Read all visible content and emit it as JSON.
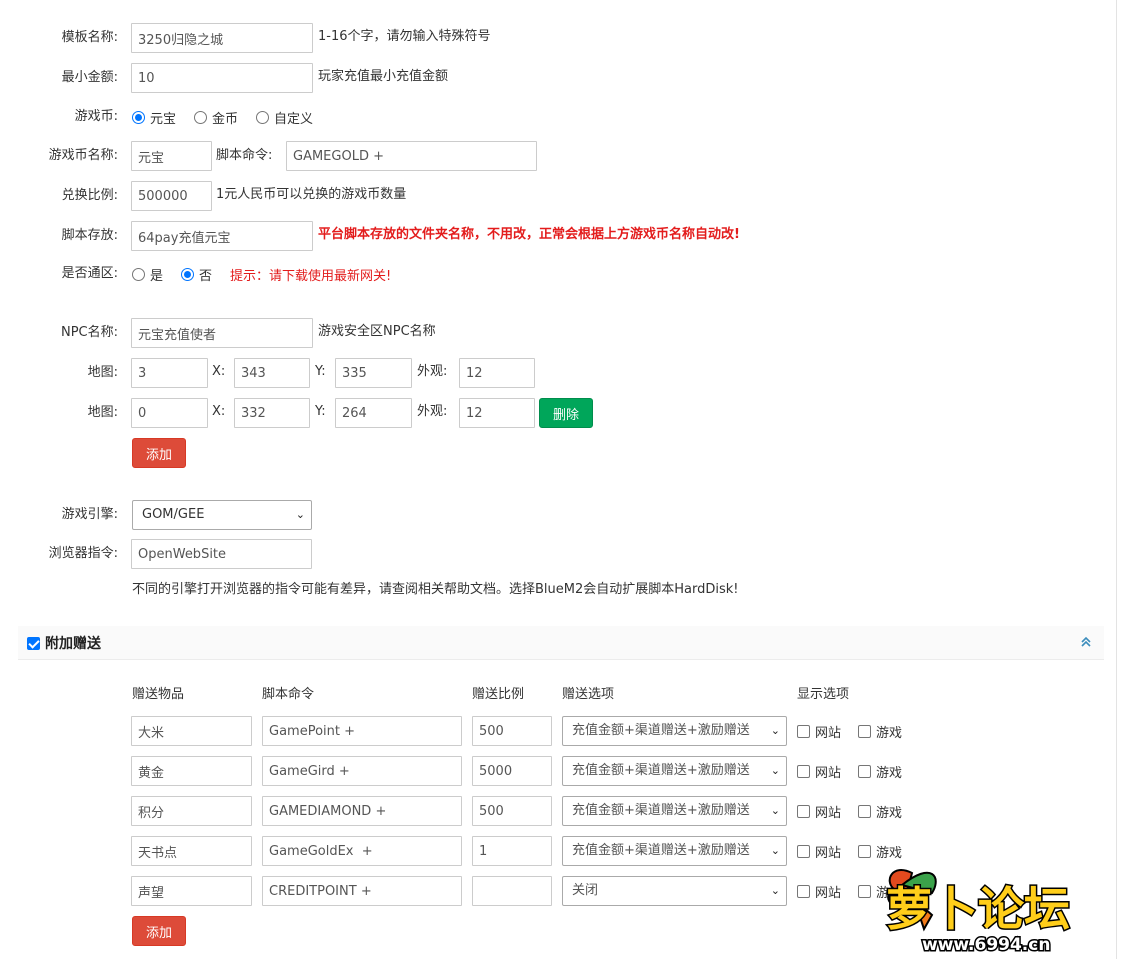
{
  "form": {
    "template_name": {
      "label": "模板名称:",
      "value": "3250归隐之城",
      "hint": "1-16个字，请勿输入特殊符号"
    },
    "min_amount": {
      "label": "最小金额:",
      "value": "10",
      "hint": "玩家充值最小充值金额"
    },
    "currency": {
      "label": "游戏币:",
      "options": [
        "元宝",
        "金币",
        "自定义"
      ],
      "selected": "元宝"
    },
    "currency_name": {
      "label": "游戏币名称:",
      "value": "元宝",
      "script_label": "脚本命令:",
      "script_value": "GAMEGOLD +"
    },
    "ratio": {
      "label": "兑换比例:",
      "value": "500000",
      "hint": "1元人民币可以兑换的游戏币数量"
    },
    "script_store": {
      "label": "脚本存放:",
      "value": "64pay充值元宝",
      "hint": "平台脚本存放的文件夹名称，不用改，正常会根据上方游戏币名称自动改!"
    },
    "all_zone": {
      "label": "是否通区:",
      "options": [
        "是",
        "否"
      ],
      "selected": "否",
      "hint": "提示：请下载使用最新网关!"
    },
    "npc_name": {
      "label": "NPC名称:",
      "value": "元宝充值使者",
      "hint": "游戏安全区NPC名称"
    },
    "maps": {
      "map_label": "地图:",
      "x_label": "X:",
      "y_label": "Y:",
      "look_label": "外观:",
      "rows": [
        {
          "map": "3",
          "x": "343",
          "y": "335",
          "look": "12"
        },
        {
          "map": "0",
          "x": "332",
          "y": "264",
          "look": "12",
          "delete_label": "删除"
        }
      ],
      "add_label": "添加"
    },
    "engine": {
      "label": "游戏引擎:",
      "value": "GOM/GEE"
    },
    "browser_cmd": {
      "label": "浏览器指令:",
      "value": "OpenWebSite",
      "note": "不同的引擎打开浏览器的指令可能有差异，请查阅相关帮助文档。选择BlueM2会自动扩展脚本HardDisk!"
    }
  },
  "bonus": {
    "title": "附加赠送",
    "enabled": true,
    "headers": {
      "item": "赠送物品",
      "script": "脚本命令",
      "ratio": "赠送比例",
      "option": "赠送选项",
      "display": "显示选项"
    },
    "site_label": "网站",
    "game_label": "游戏",
    "rows": [
      {
        "item": "大米",
        "script": "GamePoint +",
        "ratio": "500",
        "option": "充值金额+渠道赠送+激励赠送"
      },
      {
        "item": "黄金",
        "script": "GameGird +",
        "ratio": "5000",
        "option": "充值金额+渠道赠送+激励赠送"
      },
      {
        "item": "积分",
        "script": "GAMEDIAMOND +",
        "ratio": "500",
        "option": "充值金额+渠道赠送+激励赠送"
      },
      {
        "item": "天书点",
        "script": "GameGoldEx  +",
        "ratio": "1",
        "option": "充值金额+渠道赠送+激励赠送"
      },
      {
        "item": "声望",
        "script": "CREDITPOINT +",
        "ratio": "",
        "option": "关闭"
      }
    ],
    "add_label": "添加"
  },
  "watermark": {
    "brand": "萝卜论坛",
    "url": "www.6994.cn"
  },
  "colors": {
    "accent_blue": "#0075ff",
    "danger_red": "#dd4b39",
    "success_green": "#00a65a",
    "hint_red": "#e31c1c",
    "collapse_icon": "#3c8dbc"
  }
}
